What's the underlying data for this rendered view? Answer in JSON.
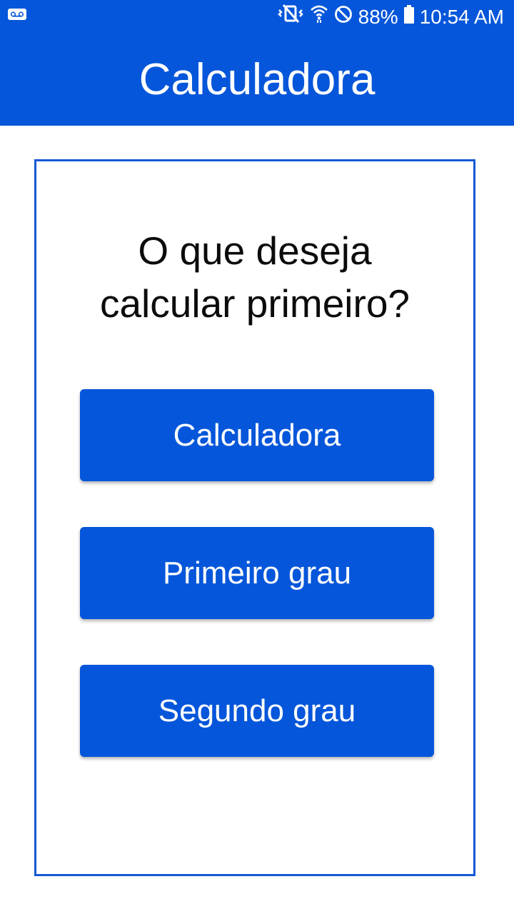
{
  "status_bar": {
    "battery_percent": "88%",
    "time": "10:54 AM",
    "icons": [
      "voicemail-icon",
      "vibrate-mute-icon",
      "wifi-icon",
      "do-not-disturb-icon",
      "battery-icon"
    ]
  },
  "app_bar": {
    "title": "Calculadora"
  },
  "card": {
    "question_lines": [
      "O que deseja",
      "calcular primeiro?"
    ],
    "buttons": [
      {
        "label": "Calculadora"
      },
      {
        "label": "Primeiro grau"
      },
      {
        "label": "Segundo grau"
      }
    ]
  },
  "colors": {
    "primary": "#0556DA",
    "card_border": "#1559D3",
    "text_dark": "#0b0b0b",
    "background": "#ffffff"
  }
}
